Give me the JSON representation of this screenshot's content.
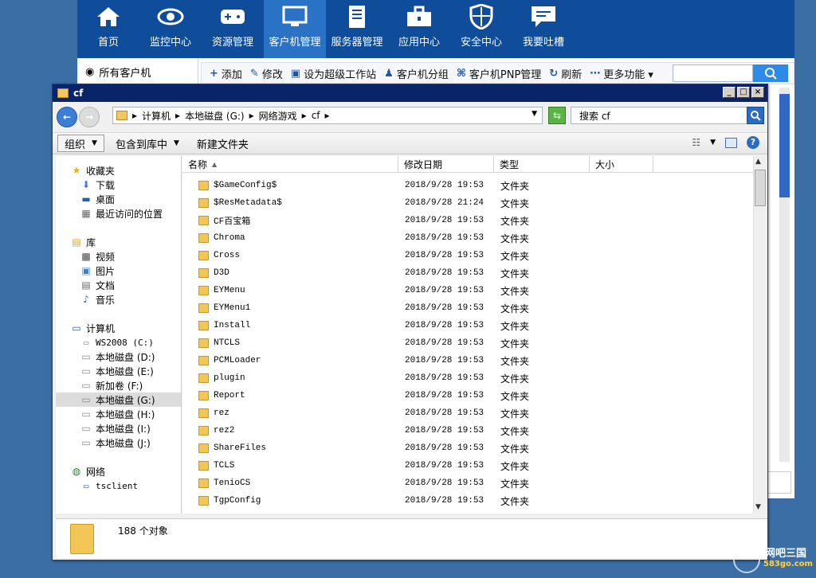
{
  "topnav": [
    {
      "label": "首页",
      "icon": "home-icon"
    },
    {
      "label": "监控中心",
      "icon": "eye-icon"
    },
    {
      "label": "资源管理",
      "icon": "gamepad-icon"
    },
    {
      "label": "客户机管理",
      "icon": "monitor-icon",
      "active": true
    },
    {
      "label": "服务器管理",
      "icon": "server-icon"
    },
    {
      "label": "应用中心",
      "icon": "toolbox-icon"
    },
    {
      "label": "安全中心",
      "icon": "shield-icon"
    },
    {
      "label": "我要吐槽",
      "icon": "comment-icon"
    }
  ],
  "bg": {
    "left_label": "所有客户机",
    "tools": [
      {
        "icon": "plus-icon",
        "glyph": "+",
        "label": "添加"
      },
      {
        "icon": "edit-icon",
        "glyph": "✎",
        "label": "修改"
      },
      {
        "icon": "workstation-icon",
        "glyph": "▣",
        "label": "设为超级工作站"
      },
      {
        "icon": "group-icon",
        "glyph": "♟",
        "label": "客户机分组"
      },
      {
        "icon": "pnp-icon",
        "glyph": "⌘",
        "label": "客户机PNP管理"
      },
      {
        "icon": "refresh-icon",
        "glyph": "↻",
        "label": "刷新"
      },
      {
        "icon": "more-icon",
        "glyph": "⋯",
        "label": "更多功能 ▾"
      }
    ]
  },
  "window": {
    "title": "cf",
    "address": [
      "计算机",
      "本地磁盘 (G:)",
      "网络游戏",
      "cf"
    ],
    "search_placeholder": "搜索 cf",
    "cmd": {
      "organize": "组织",
      "include": "包含到库中",
      "newfolder": "新建文件夹"
    },
    "columns": [
      "名称",
      "修改日期",
      "类型",
      "大小"
    ],
    "status": "188 个对象"
  },
  "nav": {
    "favorites": "收藏夹",
    "downloads": "下载",
    "desktop": "桌面",
    "recent": "最近访问的位置",
    "libraries": "库",
    "videos": "视频",
    "pictures": "图片",
    "documents": "文档",
    "music": "音乐",
    "computer": "计算机",
    "drives": [
      "WS2008 (C:)",
      "本地磁盘 (D:)",
      "本地磁盘 (E:)",
      "新加卷 (F:)",
      "本地磁盘 (G:)",
      "本地磁盘 (H:)",
      "本地磁盘 (I:)",
      "本地磁盘 (J:)"
    ],
    "network": "网络",
    "tsclient": "tsclient"
  },
  "files": [
    {
      "name": "$GameConfig$",
      "date": "2018/9/28 19:53",
      "type": "文件夹"
    },
    {
      "name": "$ResMetadata$",
      "date": "2018/9/28 21:24",
      "type": "文件夹"
    },
    {
      "name": "CF百宝箱",
      "date": "2018/9/28 19:53",
      "type": "文件夹"
    },
    {
      "name": "Chroma",
      "date": "2018/9/28 19:53",
      "type": "文件夹"
    },
    {
      "name": "Cross",
      "date": "2018/9/28 19:53",
      "type": "文件夹"
    },
    {
      "name": "D3D",
      "date": "2018/9/28 19:53",
      "type": "文件夹"
    },
    {
      "name": "EYMenu",
      "date": "2018/9/28 19:53",
      "type": "文件夹"
    },
    {
      "name": "EYMenu1",
      "date": "2018/9/28 19:53",
      "type": "文件夹"
    },
    {
      "name": "Install",
      "date": "2018/9/28 19:53",
      "type": "文件夹"
    },
    {
      "name": "NTCLS",
      "date": "2018/9/28 19:53",
      "type": "文件夹"
    },
    {
      "name": "PCMLoader",
      "date": "2018/9/28 19:53",
      "type": "文件夹"
    },
    {
      "name": "plugin",
      "date": "2018/9/28 19:53",
      "type": "文件夹"
    },
    {
      "name": "Report",
      "date": "2018/9/28 19:53",
      "type": "文件夹"
    },
    {
      "name": "rez",
      "date": "2018/9/28 19:53",
      "type": "文件夹"
    },
    {
      "name": "rez2",
      "date": "2018/9/28 19:53",
      "type": "文件夹"
    },
    {
      "name": "ShareFiles",
      "date": "2018/9/28 19:53",
      "type": "文件夹"
    },
    {
      "name": "TCLS",
      "date": "2018/9/28 19:53",
      "type": "文件夹"
    },
    {
      "name": "TenioCS",
      "date": "2018/9/28 19:53",
      "type": "文件夹"
    },
    {
      "name": "TgpConfig",
      "date": "2018/9/28 19:53",
      "type": "文件夹"
    }
  ],
  "watermark": {
    "brand": "网吧三国",
    "site": "583go.com"
  },
  "colors": {
    "nav_bg": "#0f4c9a",
    "nav_active": "#2a72c6",
    "title_bg": "#0a246a",
    "folder": "#f4c657"
  }
}
